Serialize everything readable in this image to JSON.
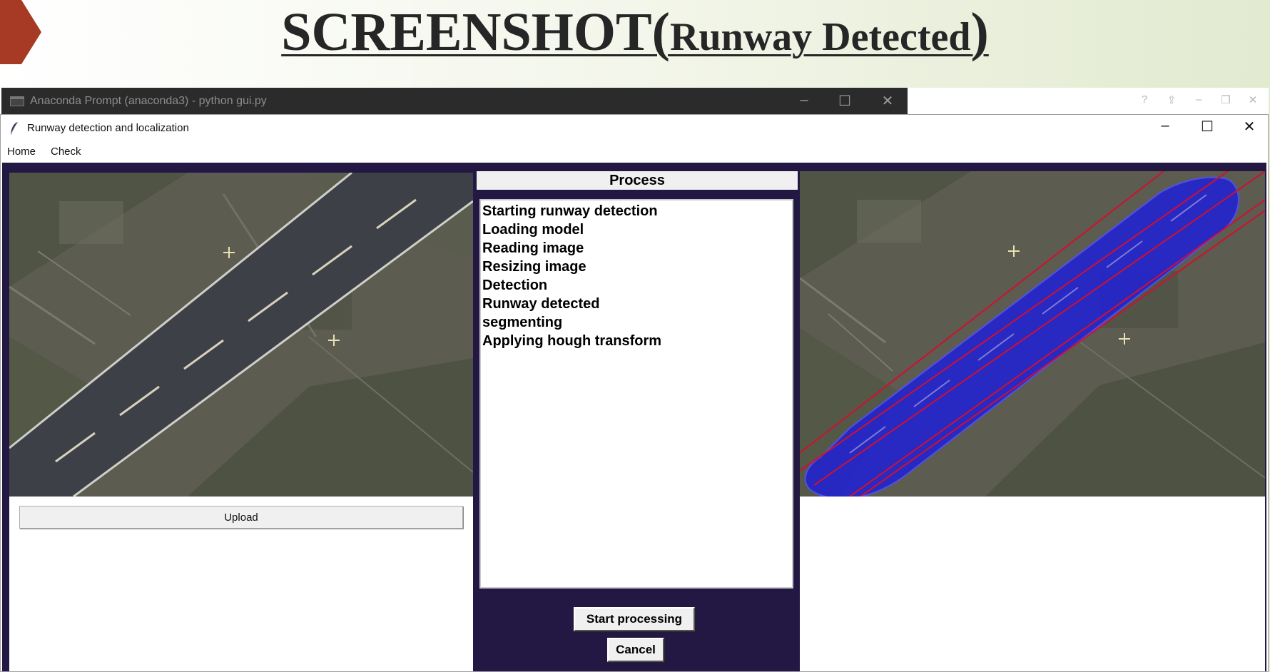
{
  "slide": {
    "title_main": "SCREENSHOT(",
    "title_sub": "Runway Detected",
    "title_end": ")",
    "accent_color": "#a63a24"
  },
  "console": {
    "title": "Anaconda Prompt (anaconda3) - python  gui.py",
    "icon": "terminal-icon",
    "minimize": "–",
    "maximize": "☐",
    "close": "✕"
  },
  "help_bar": {
    "icons": [
      "?",
      "⇪",
      "–",
      "❐",
      "✕"
    ]
  },
  "window": {
    "title": "Runway detection and localization",
    "icon": "feather-icon",
    "minimize": "–",
    "maximize": "☐",
    "close": "✕"
  },
  "menu": {
    "items": [
      "Home",
      "Check"
    ]
  },
  "left": {
    "upload_label": "Upload"
  },
  "process": {
    "label": "Process",
    "log": [
      "Starting runway detection",
      "Loading model",
      "Reading image",
      "Resizing image",
      "Detection",
      "Runway detected",
      "segmenting",
      "Applying hough transform"
    ],
    "start_label": "Start processing",
    "cancel_label": "Cancel"
  },
  "colors": {
    "content_bg": "#231843",
    "runway_mask": "#2020d8",
    "hough_lines": "#d01030"
  }
}
